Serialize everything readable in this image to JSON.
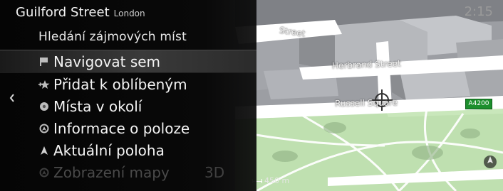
{
  "header": {
    "street": "Guilford Street",
    "city": "London"
  },
  "clock": "2:15",
  "subtitle": "Hledání zájmových míst",
  "menu": [
    {
      "label": "Navigovat sem",
      "icon": "flag-icon",
      "selected": true
    },
    {
      "label": "Přidat k oblíbeným",
      "icon": "add-favorite-star-icon"
    },
    {
      "label": "Místa v okolí",
      "icon": "poi-icon"
    },
    {
      "label": "Informace o poloze",
      "icon": "location-info-icon"
    },
    {
      "label": "Aktuální poloha",
      "icon": "current-position-arrow-icon"
    },
    {
      "label": "Zobrazení mapy",
      "icon": "map-view-icon",
      "value": "3D",
      "dimmed": true
    }
  ],
  "map": {
    "labels": [
      "Street",
      "Herbrand Street",
      "Russell Square"
    ],
    "road_badge": "A4200",
    "scale": "450 m"
  },
  "colors": {
    "park": "#bfe0b0",
    "road": "#ffffff",
    "building": "#8d8f94",
    "route_badge": "#1c8f2d"
  }
}
